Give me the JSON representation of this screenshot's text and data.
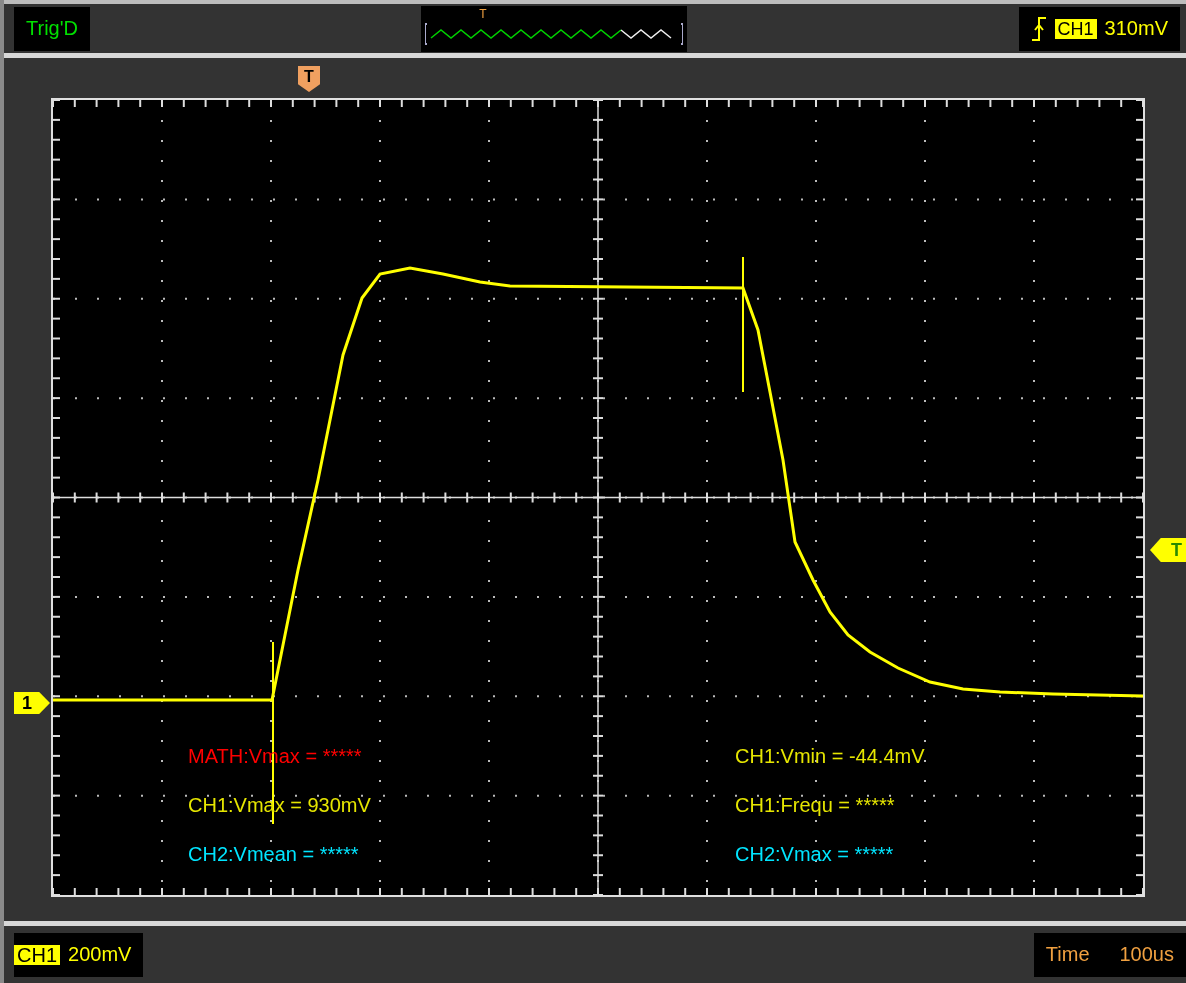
{
  "status": {
    "label": "Trig'D"
  },
  "preview": {
    "trigger_label": "T"
  },
  "trigger": {
    "channel": "CH1",
    "voltage": "310mV"
  },
  "markers": {
    "trigger_position": "T",
    "channel": "1",
    "trigger_level": "T"
  },
  "measurements": [
    {
      "text": "MATH:Vmax = *****",
      "color": "#ff0000"
    },
    {
      "text": "CH1:Vmin = -44.4mV",
      "color": "#e6e600"
    },
    {
      "text": "CH1:Vmax = 930mV",
      "color": "#e6e600"
    },
    {
      "text": "CH1:Frequ = *****",
      "color": "#e6e600"
    },
    {
      "text": "CH2:Vmean = *****",
      "color": "#00e5ff"
    },
    {
      "text": "CH2:Vmax = *****",
      "color": "#00e5ff"
    }
  ],
  "channel_scale": {
    "channel": "CH1",
    "scale": "200mV"
  },
  "timebase": {
    "label": "Time",
    "value": "100us"
  }
}
